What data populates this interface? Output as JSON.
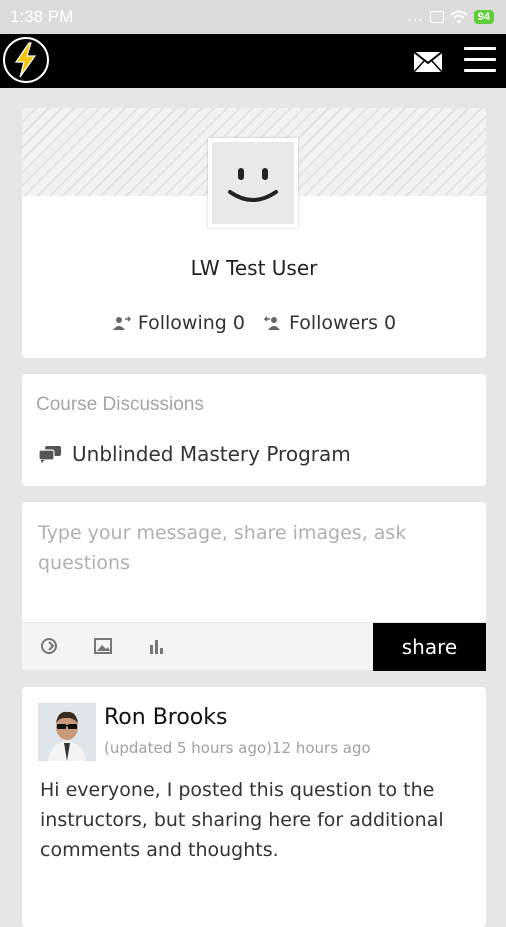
{
  "status_bar": {
    "time": "1:38 PM",
    "dots": "...",
    "battery": "94"
  },
  "app_bar": {
    "logo": "lightning-bolt-logo",
    "icons": [
      "mail-icon",
      "hamburger-menu-icon"
    ]
  },
  "profile": {
    "name": "LW Test User",
    "following_label": "Following",
    "following_count": "0",
    "followers_label": "Followers",
    "followers_count": "0"
  },
  "course_discussions": {
    "heading": "Course Discussions",
    "items": [
      {
        "label": "Unblinded Mastery Program",
        "icon": "chat-bubbles-icon"
      }
    ]
  },
  "composer": {
    "placeholder": "Type your message, share images, ask questions",
    "tools": [
      "link-icon",
      "image-icon",
      "poll-icon"
    ],
    "share_label": "share"
  },
  "feed": {
    "posts": [
      {
        "author": "Ron Brooks",
        "updated": "(updated 5 hours ago)",
        "time": "12 hours ago",
        "body": "Hi everyone, I posted this question to the instructors, but sharing here for additional comments and thoughts."
      }
    ]
  },
  "colors": {
    "app_bar": "#000000",
    "logo_bolt": "#f5c400",
    "share_button": "#000000",
    "battery": "#5ecf3a"
  }
}
